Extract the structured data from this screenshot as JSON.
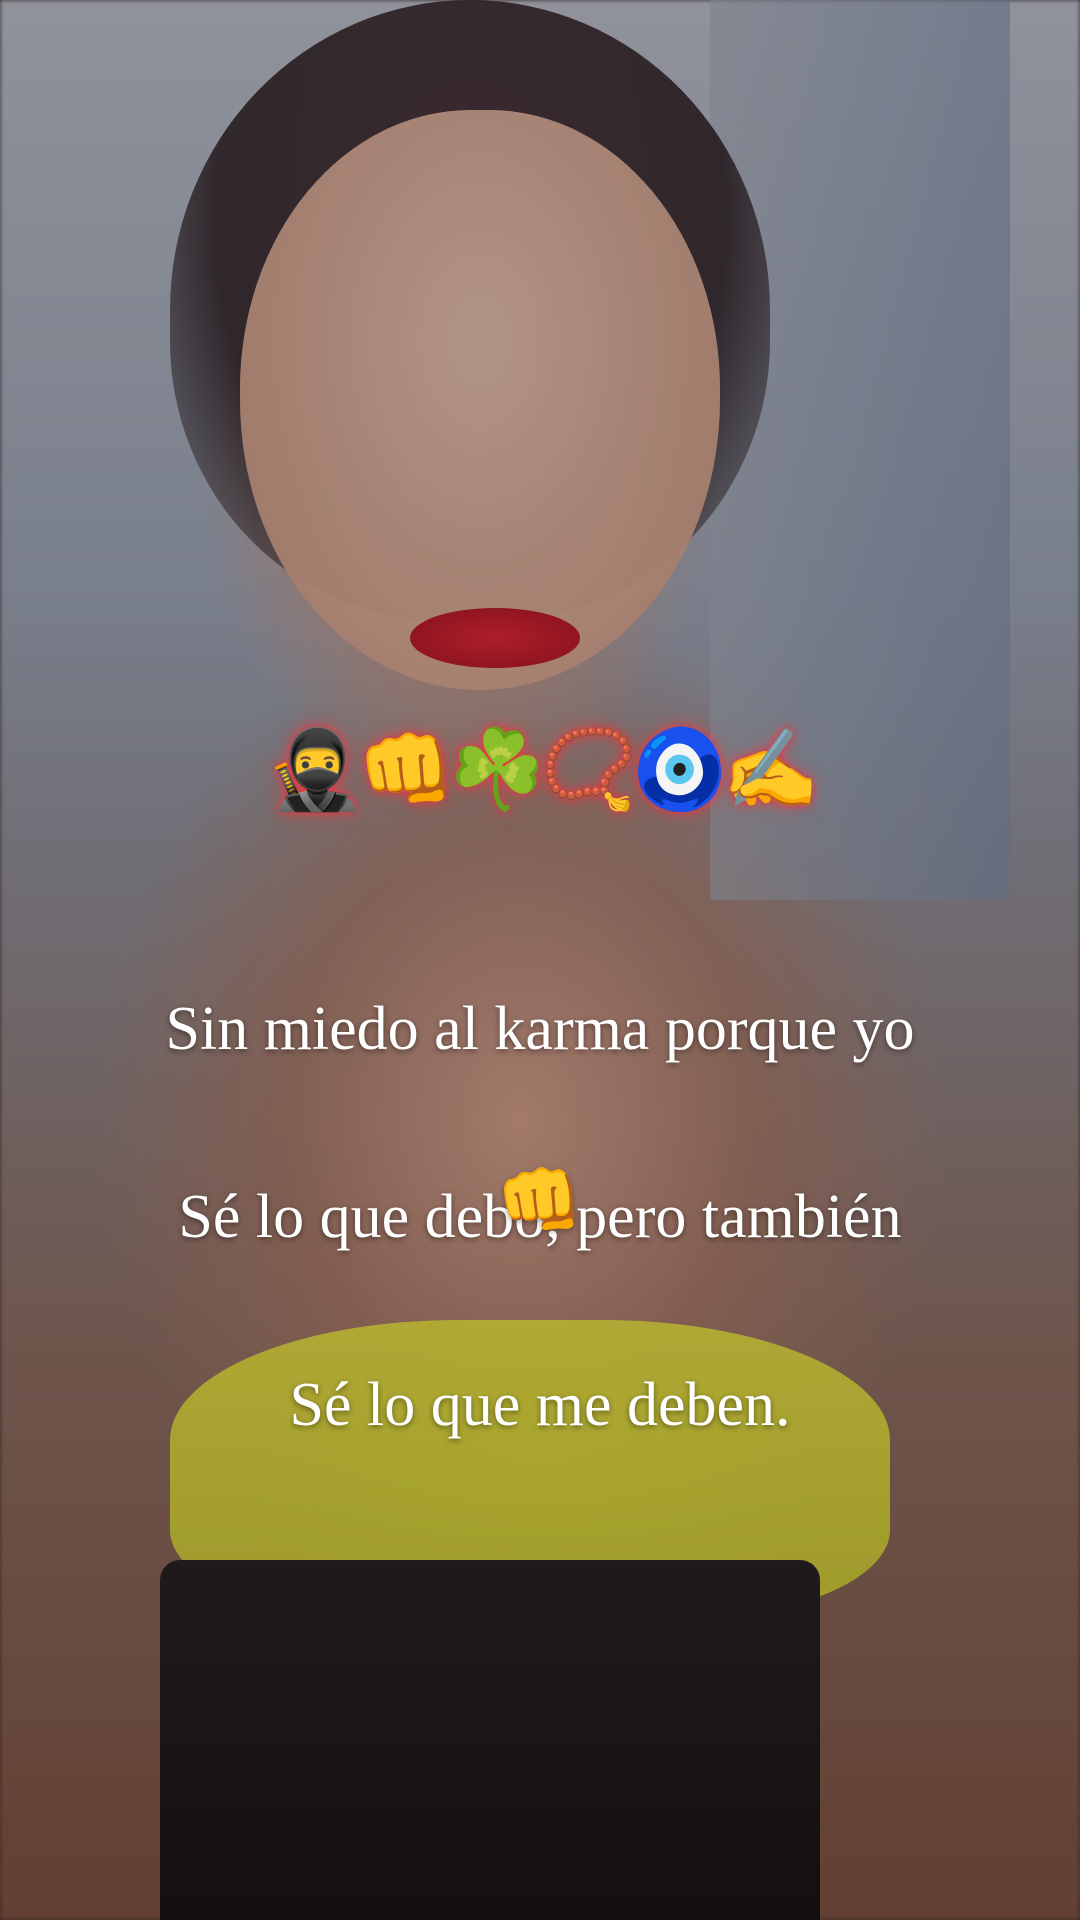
{
  "story": {
    "emoji_row": "🥷👊☘️📿🧿✍️",
    "caption_lines": [
      "Sin miedo al karma porque yo",
      "Sé lo que debo, pero también",
      "Sé lo que me deben."
    ],
    "trailing_emoji": "👊"
  },
  "colors": {
    "caption_text": "#ffffff",
    "emoji_glow": "#ff2a3c"
  }
}
